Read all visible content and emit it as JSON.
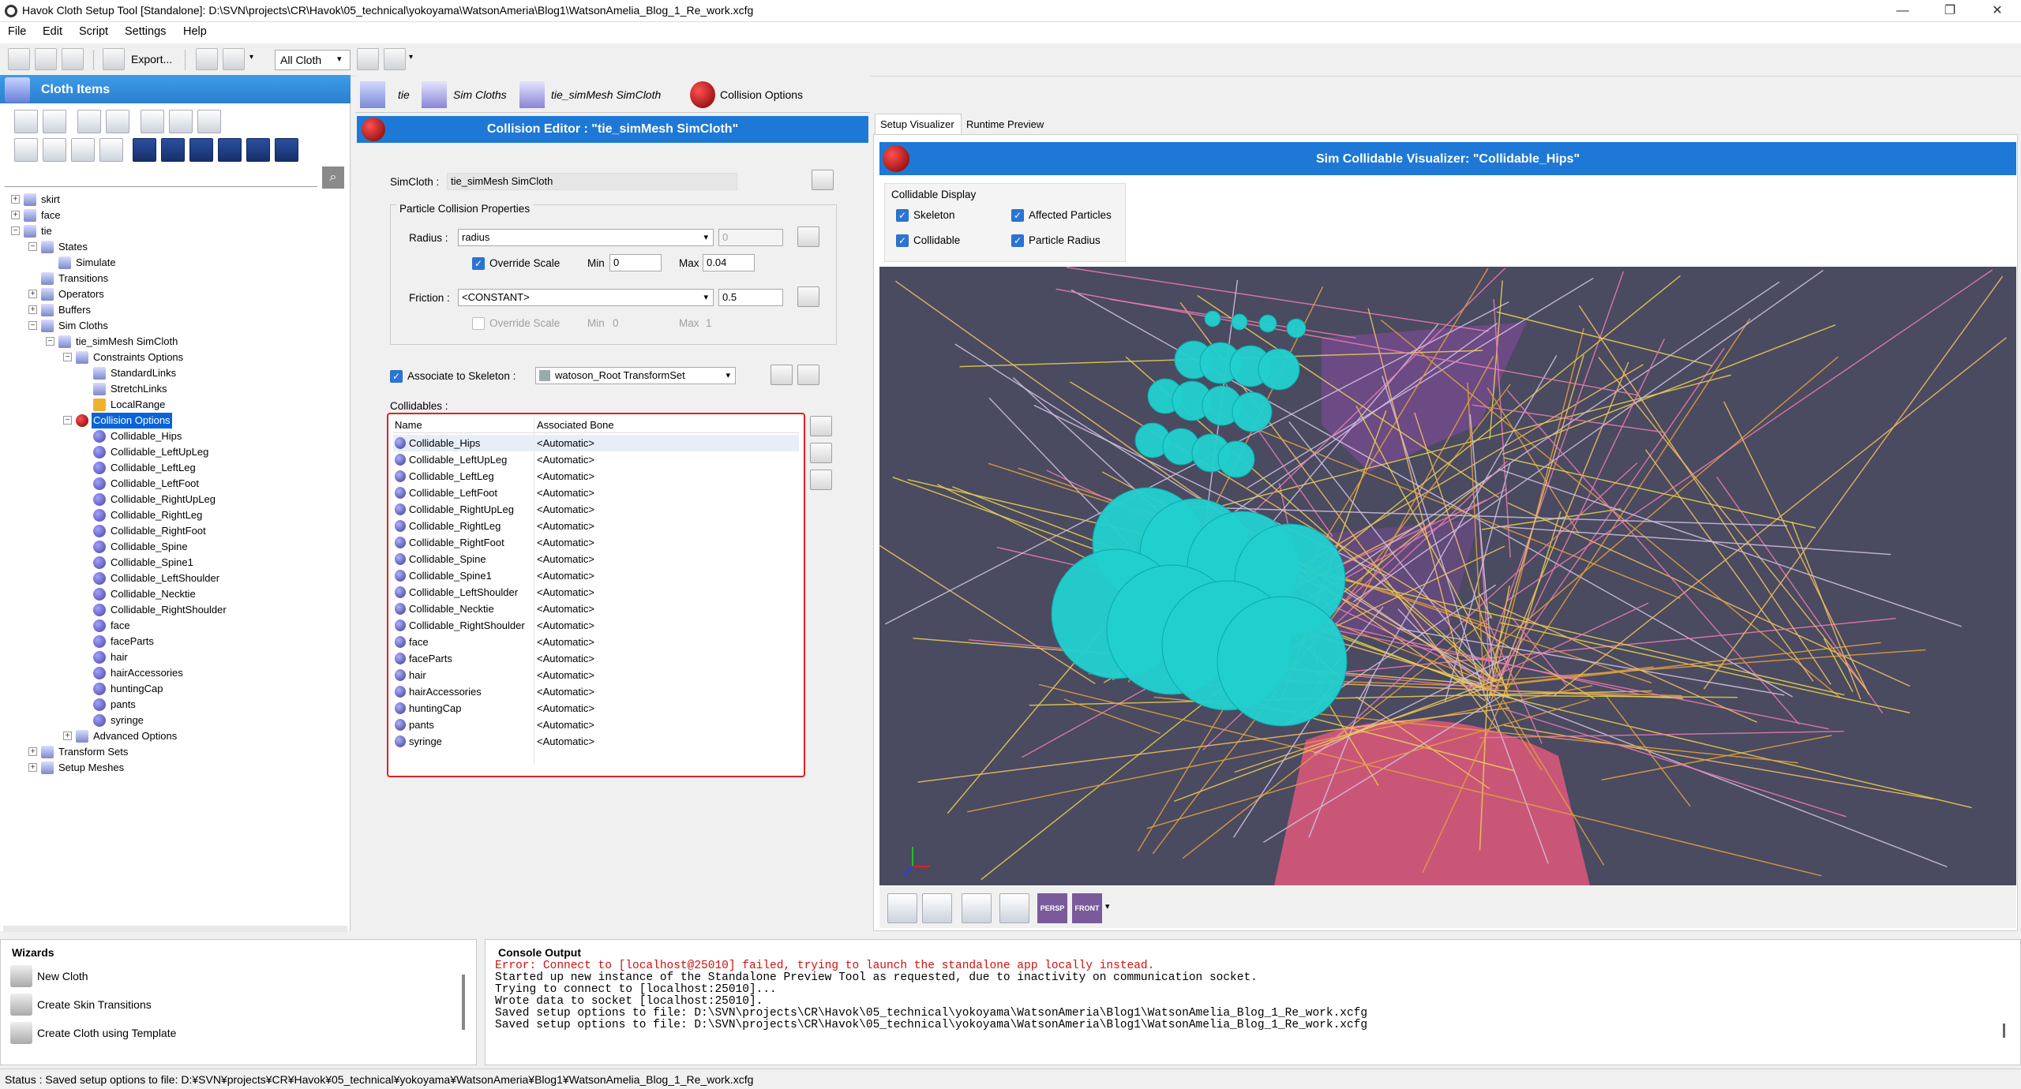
{
  "window": {
    "title": "Havok Cloth Setup Tool [Standalone]: D:\\SVN\\projects\\CR\\Havok\\05_technical\\yokoyama\\WatsonAmeria\\Blog1\\WatsonAmelia_Blog_1_Re_work.xcfg",
    "min": "—",
    "max": "❐",
    "close": "✕"
  },
  "menu": [
    "File",
    "Edit",
    "Script",
    "Settings",
    "Help"
  ],
  "toolbar": {
    "export_label": "Export...",
    "filter_value": "All Cloth"
  },
  "cloth_items": {
    "title": "Cloth Items",
    "search_placeholder": "",
    "tree": [
      {
        "label": "skirt",
        "level": 0,
        "exp": "+"
      },
      {
        "label": "face",
        "level": 0,
        "exp": "+"
      },
      {
        "label": "tie",
        "level": 0,
        "exp": "−"
      },
      {
        "label": "States",
        "level": 1,
        "exp": "−"
      },
      {
        "label": "Simulate",
        "level": 2,
        "exp": ""
      },
      {
        "label": "Transitions",
        "level": 1,
        "exp": ""
      },
      {
        "label": "Operators",
        "level": 1,
        "exp": "+"
      },
      {
        "label": "Buffers",
        "level": 1,
        "exp": "+"
      },
      {
        "label": "Sim Cloths",
        "level": 1,
        "exp": "−"
      },
      {
        "label": "tie_simMesh SimCloth",
        "level": 2,
        "exp": "−"
      },
      {
        "label": "Constraints Options",
        "level": 3,
        "exp": "−"
      },
      {
        "label": "StandardLinks",
        "level": 4,
        "exp": ""
      },
      {
        "label": "StretchLinks",
        "level": 4,
        "exp": ""
      },
      {
        "label": "LocalRange",
        "level": 4,
        "exp": ""
      },
      {
        "label": "Collision Options",
        "level": 3,
        "exp": "−",
        "selected": true
      },
      {
        "label": "Collidable_Hips",
        "level": 4,
        "exp": ""
      },
      {
        "label": "Collidable_LeftUpLeg",
        "level": 4,
        "exp": ""
      },
      {
        "label": "Collidable_LeftLeg",
        "level": 4,
        "exp": ""
      },
      {
        "label": "Collidable_LeftFoot",
        "level": 4,
        "exp": ""
      },
      {
        "label": "Collidable_RightUpLeg",
        "level": 4,
        "exp": ""
      },
      {
        "label": "Collidable_RightLeg",
        "level": 4,
        "exp": ""
      },
      {
        "label": "Collidable_RightFoot",
        "level": 4,
        "exp": ""
      },
      {
        "label": "Collidable_Spine",
        "level": 4,
        "exp": ""
      },
      {
        "label": "Collidable_Spine1",
        "level": 4,
        "exp": ""
      },
      {
        "label": "Collidable_LeftShoulder",
        "level": 4,
        "exp": ""
      },
      {
        "label": "Collidable_Necktie",
        "level": 4,
        "exp": ""
      },
      {
        "label": "Collidable_RightShoulder",
        "level": 4,
        "exp": ""
      },
      {
        "label": "face",
        "level": 4,
        "exp": ""
      },
      {
        "label": "faceParts",
        "level": 4,
        "exp": ""
      },
      {
        "label": "hair",
        "level": 4,
        "exp": ""
      },
      {
        "label": "hairAccessories",
        "level": 4,
        "exp": ""
      },
      {
        "label": "huntingCap",
        "level": 4,
        "exp": ""
      },
      {
        "label": "pants",
        "level": 4,
        "exp": ""
      },
      {
        "label": "syringe",
        "level": 4,
        "exp": ""
      },
      {
        "label": "Advanced Options",
        "level": 3,
        "exp": "+"
      },
      {
        "label": "Transform Sets",
        "level": 1,
        "exp": "+"
      },
      {
        "label": "Setup Meshes",
        "level": 1,
        "exp": "+"
      }
    ]
  },
  "breadcrumb": [
    "tie",
    "Sim Cloths",
    "tie_simMesh SimCloth",
    "Collision Options"
  ],
  "editor": {
    "title": "Collision Editor : \"tie_simMesh SimCloth\"",
    "simcloth_label": "SimCloth :",
    "simcloth_value": "tie_simMesh SimCloth",
    "group_title": "Particle Collision Properties",
    "radius_label": "Radius :",
    "radius_value": "radius",
    "radius_num": "0",
    "override_label": "Override Scale",
    "min_label": "Min",
    "min_value": "0",
    "max_label": "Max",
    "max_value": "0.04",
    "friction_label": "Friction :",
    "friction_value": "<CONSTANT>",
    "friction_num": "0.5",
    "override2_label": "Override Scale",
    "min2_label": "Min",
    "min2_value": "0",
    "max2_label": "Max",
    "max2_value": "1",
    "assoc_label": "Associate to Skeleton :",
    "assoc_value": "watoson_Root TransformSet",
    "collidables_label": "Collidables :",
    "col_name": "Name",
    "col_bone": "Associated Bone",
    "rows": [
      {
        "name": "Collidable_Hips",
        "bone": "<Automatic>"
      },
      {
        "name": "Collidable_LeftUpLeg",
        "bone": "<Automatic>"
      },
      {
        "name": "Collidable_LeftLeg",
        "bone": "<Automatic>"
      },
      {
        "name": "Collidable_LeftFoot",
        "bone": "<Automatic>"
      },
      {
        "name": "Collidable_RightUpLeg",
        "bone": "<Automatic>"
      },
      {
        "name": "Collidable_RightLeg",
        "bone": "<Automatic>"
      },
      {
        "name": "Collidable_RightFoot",
        "bone": "<Automatic>"
      },
      {
        "name": "Collidable_Spine",
        "bone": "<Automatic>"
      },
      {
        "name": "Collidable_Spine1",
        "bone": "<Automatic>"
      },
      {
        "name": "Collidable_LeftShoulder",
        "bone": "<Automatic>"
      },
      {
        "name": "Collidable_Necktie",
        "bone": "<Automatic>"
      },
      {
        "name": "Collidable_RightShoulder",
        "bone": "<Automatic>"
      },
      {
        "name": "face",
        "bone": "<Automatic>"
      },
      {
        "name": "faceParts",
        "bone": "<Automatic>"
      },
      {
        "name": "hair",
        "bone": "<Automatic>"
      },
      {
        "name": "hairAccessories",
        "bone": "<Automatic>"
      },
      {
        "name": "huntingCap",
        "bone": "<Automatic>"
      },
      {
        "name": "pants",
        "bone": "<Automatic>"
      },
      {
        "name": "syringe",
        "bone": "<Automatic>"
      }
    ]
  },
  "visualizer": {
    "tabs": [
      "Setup Visualizer",
      "Runtime Preview"
    ],
    "title": "Sim Collidable Visualizer: \"Collidable_Hips\"",
    "display_group": "Collidable Display",
    "skeleton": "Skeleton",
    "collidable": "Collidable",
    "affected": "Affected Particles",
    "particle_radius": "Particle Radius",
    "persp": "PERSP",
    "front": "FRONT"
  },
  "wizards": {
    "title": "Wizards",
    "items": [
      "New Cloth",
      "Create Skin Transitions",
      "Create Cloth using Template"
    ]
  },
  "console": {
    "title": "Console Output",
    "error_line": "Error: Connect to [localhost@25010] failed, trying to launch the standalone app locally instead.",
    "lines": [
      "Started up new instance of the Standalone Preview Tool as requested, due to inactivity on communication socket.",
      "Trying to connect to [localhost:25010]...",
      "Wrote data to socket [localhost:25010].",
      "Saved setup options to file: D:\\SVN\\projects\\CR\\Havok\\05_technical\\yokoyama\\WatsonAmeria\\Blog1\\WatsonAmelia_Blog_1_Re_work.xcfg",
      "Saved setup options to file: D:\\SVN\\projects\\CR\\Havok\\05_technical\\yokoyama\\WatsonAmeria\\Blog1\\WatsonAmelia_Blog_1_Re_work.xcfg"
    ]
  },
  "status": "Status : Saved setup options to file: D:¥SVN¥projects¥CR¥Havok¥05_technical¥yokoyama¥WatsonAmeria¥Blog1¥WatsonAmelia_Blog_1_Re_work.xcfg",
  "colors": {
    "accent": "#1e78d6",
    "selection": "#0a64d8",
    "highlight_border": "#e02020",
    "viewport_bg": "#4a4a60",
    "sphere": "#22d0d0",
    "error": "#d01010"
  }
}
